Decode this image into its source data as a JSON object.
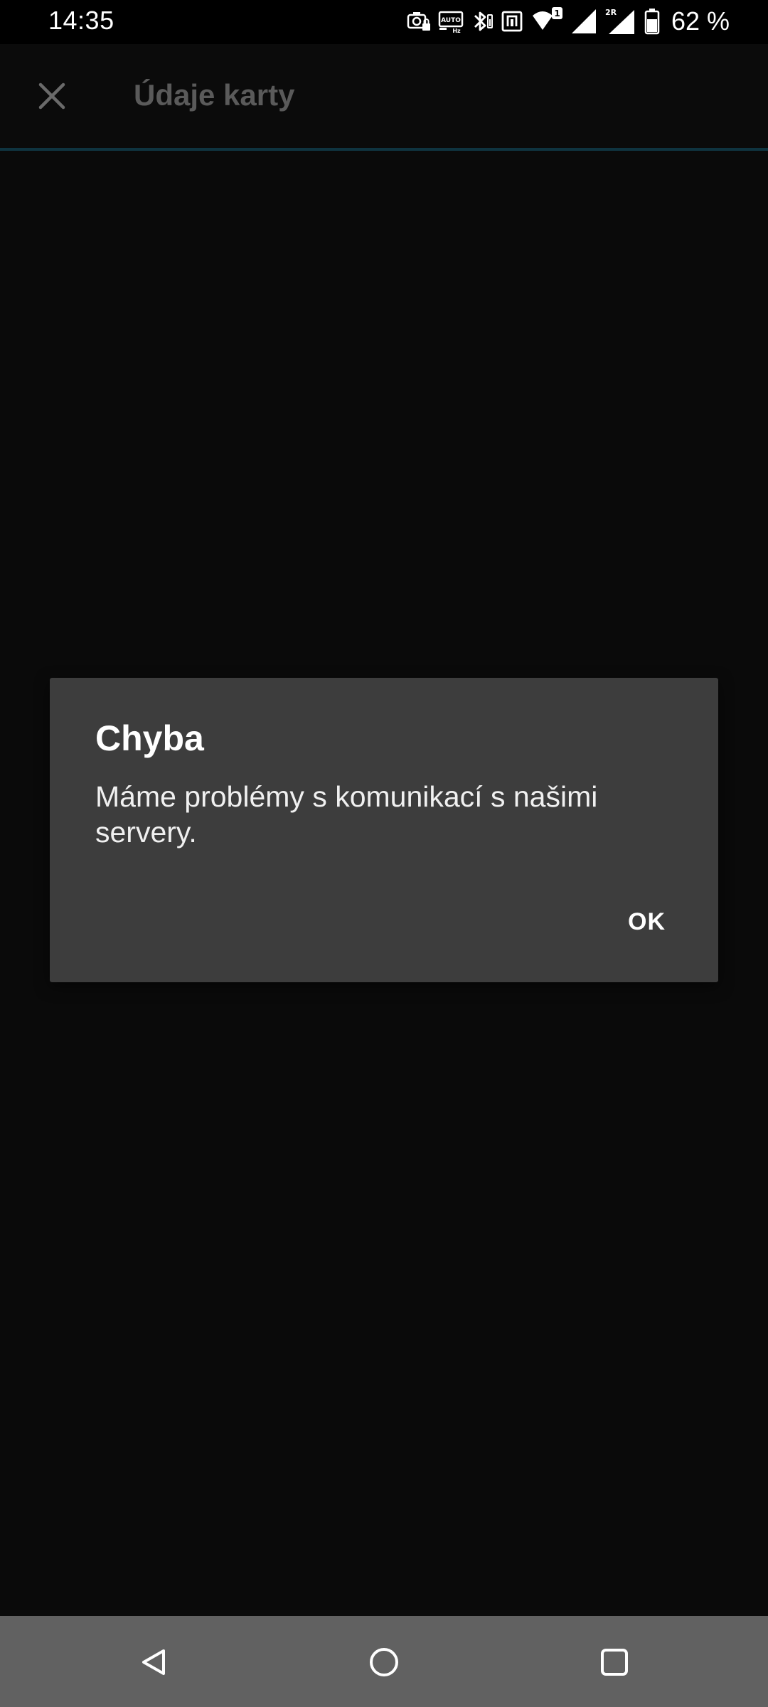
{
  "status_bar": {
    "time": "14:35",
    "battery_text": "62 %",
    "icons": [
      "camera-lock-icon",
      "auto-hz-icon",
      "bluetooth-icon",
      "nfc-icon",
      "wifi-icon",
      "signal-1-icon",
      "signal-2r-icon",
      "battery-icon"
    ],
    "signal_badge_1": "1",
    "signal_badge_2": "2R",
    "auto_label": "AUTO",
    "hz_label": "Hz"
  },
  "toolbar": {
    "title": "Údaje karty"
  },
  "dialog": {
    "title": "Chyba",
    "message": "Máme problémy s komunikací s našimi servery.",
    "ok_label": "OK"
  },
  "nav_bar": {
    "buttons": [
      "back-icon",
      "home-icon",
      "recents-icon"
    ]
  },
  "colors": {
    "background": "#0a0a0a",
    "dialog_bg": "#3d3d3d",
    "nav_bar_bg": "#616161",
    "toolbar_divider": "#0f3440"
  }
}
